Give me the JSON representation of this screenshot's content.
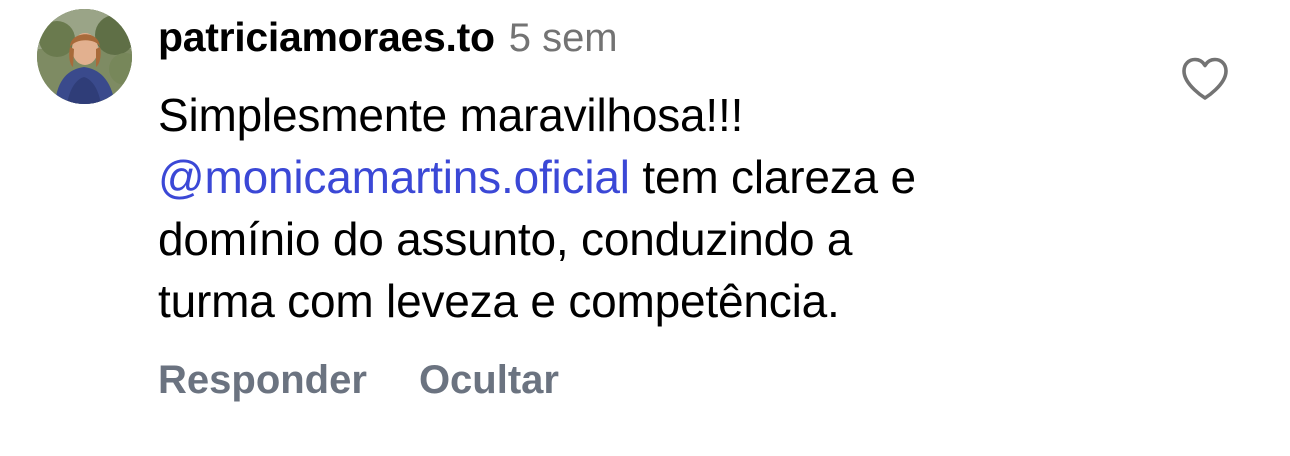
{
  "comment": {
    "username": "patriciamoraes.to",
    "timestamp": "5 sem",
    "text_line_1": "Simplesmente maravilhosa!!!",
    "mention": "@monicamartins.oficial",
    "text_line_2_rest": " tem clareza e",
    "text_line_3": "domínio do assunto, conduzindo a",
    "text_line_4": "turma com leveza e competência.",
    "avatar_icon": "user-avatar-photo",
    "like_icon": "heart-outline-icon"
  },
  "actions": {
    "reply_label": "Responder",
    "hide_label": "Ocultar"
  },
  "colors": {
    "mention": "#3b48d6",
    "timestamp": "#737373",
    "action": "#6b7380"
  }
}
